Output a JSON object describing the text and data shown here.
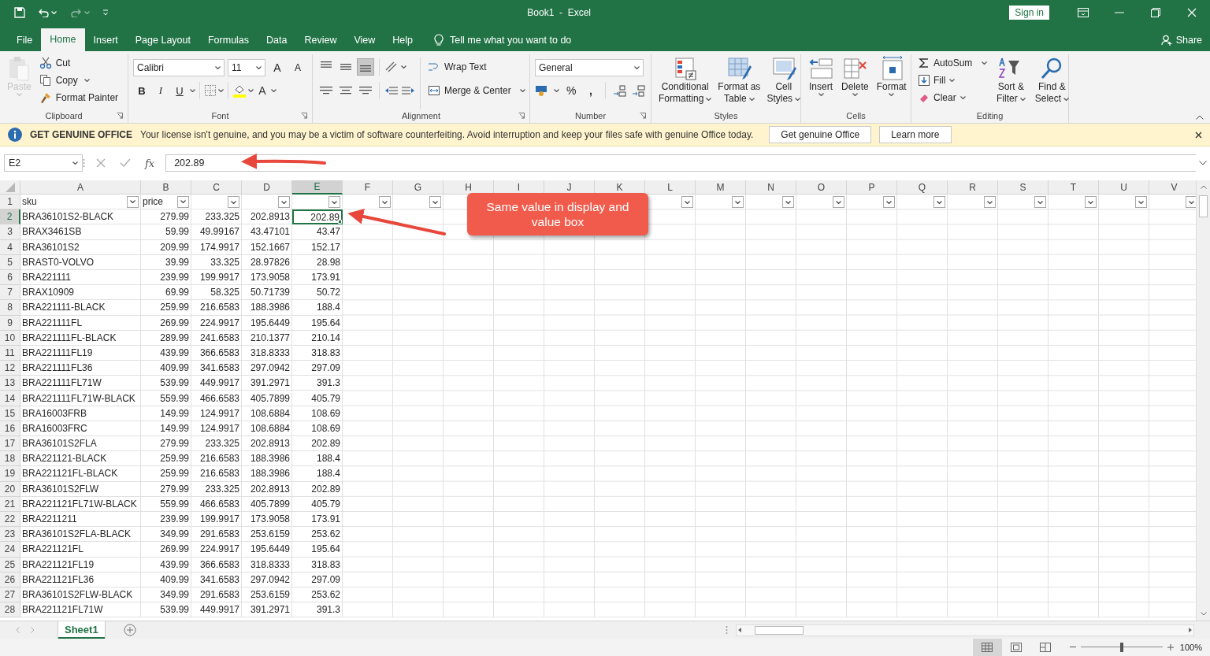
{
  "title_bar": {
    "title": "Book1  -  Excel",
    "sign_in": "Sign in"
  },
  "tabs": [
    {
      "label": "File",
      "selected": false
    },
    {
      "label": "Home",
      "selected": true
    },
    {
      "label": "Insert",
      "selected": false
    },
    {
      "label": "Page Layout",
      "selected": false
    },
    {
      "label": "Formulas",
      "selected": false
    },
    {
      "label": "Data",
      "selected": false
    },
    {
      "label": "Review",
      "selected": false
    },
    {
      "label": "View",
      "selected": false
    },
    {
      "label": "Help",
      "selected": false
    }
  ],
  "tell_me": "Tell me what you want to do",
  "share": "Share",
  "ribbon": {
    "clipboard": {
      "label": "Clipboard",
      "paste": {
        "label": "Paste",
        "disabled": true
      },
      "cut": "Cut",
      "copy": "Copy",
      "format_painter": "Format Painter"
    },
    "font": {
      "label": "Font",
      "name": "Calibri",
      "size": "11",
      "grow": "A",
      "shrink": "A",
      "bold": "B",
      "italic": "I",
      "underline": "U",
      "font_color_label": "A"
    },
    "alignment": {
      "label": "Alignment",
      "vertical": [
        {
          "selected": false
        },
        {
          "selected": false
        },
        {
          "selected": true
        }
      ],
      "wrap": "Wrap Text",
      "merge": "Merge & Center"
    },
    "number": {
      "label": "Number",
      "format": "General",
      "percent": "%",
      "comma": ","
    },
    "styles": {
      "label": "Styles",
      "buttons": [
        {
          "lines": [
            "Conditional",
            "Formatting"
          ]
        },
        {
          "lines": [
            "Format as",
            "Table"
          ]
        },
        {
          "lines": [
            "Cell",
            "Styles"
          ]
        }
      ]
    },
    "cells": {
      "label": "Cells",
      "buttons": [
        {
          "lines": [
            "Insert"
          ]
        },
        {
          "lines": [
            "Delete"
          ]
        },
        {
          "lines": [
            "Format"
          ]
        }
      ]
    },
    "editing": {
      "label": "Editing",
      "autosum": "AutoSum",
      "fill": "Fill",
      "clear": "Clear",
      "buttons": [
        {
          "lines": [
            "Sort &",
            "Filter"
          ]
        },
        {
          "lines": [
            "Find &",
            "Select"
          ]
        }
      ]
    }
  },
  "notice": {
    "title": "GET GENUINE OFFICE",
    "message": "Your license isn't genuine, and you may be a victim of software counterfeiting. Avoid interruption and keep your files safe with genuine Office today.",
    "buttons": [
      "Get genuine Office",
      "Learn more"
    ]
  },
  "formula_bar": {
    "name_box": "E2",
    "function": "fx",
    "value": "202.89"
  },
  "columns": [
    {
      "label": "A",
      "selected": false,
      "filter": true,
      "heading": "sku"
    },
    {
      "label": "B",
      "selected": false,
      "filter": true,
      "heading": "price"
    },
    {
      "label": "C",
      "selected": false,
      "filter": true
    },
    {
      "label": "D",
      "selected": false,
      "filter": true
    },
    {
      "label": "E",
      "selected": true,
      "filter": true
    },
    {
      "label": "F",
      "selected": false,
      "filter": true
    },
    {
      "label": "G",
      "selected": false,
      "filter": true
    },
    {
      "label": "H",
      "selected": false
    },
    {
      "label": "I",
      "selected": false
    },
    {
      "label": "J",
      "selected": false
    },
    {
      "label": "K",
      "selected": false
    },
    {
      "label": "L",
      "selected": false,
      "filter": true
    },
    {
      "label": "M",
      "selected": false,
      "filter": true
    },
    {
      "label": "N",
      "selected": false,
      "filter": true
    },
    {
      "label": "O",
      "selected": false,
      "filter": true
    },
    {
      "label": "P",
      "selected": false,
      "filter": true
    },
    {
      "label": "Q",
      "selected": false,
      "filter": true
    },
    {
      "label": "R",
      "selected": false,
      "filter": true
    },
    {
      "label": "S",
      "selected": false,
      "filter": true
    },
    {
      "label": "T",
      "selected": false,
      "filter": true
    },
    {
      "label": "U",
      "selected": false,
      "filter": true
    },
    {
      "label": "V",
      "selected": false,
      "filter": true
    }
  ],
  "header_row": "1",
  "rows": [
    {
      "number": "2",
      "selected": true,
      "cells": [
        "BRA36101S2-BLACK",
        "279.99",
        "233.325",
        "202.8913",
        "202.89"
      ]
    },
    {
      "number": "3",
      "selected": false,
      "cells": [
        "BRAX3461SB",
        "59.99",
        "49.99167",
        "43.47101",
        "43.47"
      ]
    },
    {
      "number": "4",
      "selected": false,
      "cells": [
        "BRA36101S2",
        "209.99",
        "174.9917",
        "152.1667",
        "152.17"
      ]
    },
    {
      "number": "5",
      "selected": false,
      "cells": [
        "BRAST0-VOLVO",
        "39.99",
        "33.325",
        "28.97826",
        "28.98"
      ]
    },
    {
      "number": "6",
      "selected": false,
      "cells": [
        "BRA221111",
        "239.99",
        "199.9917",
        "173.9058",
        "173.91"
      ]
    },
    {
      "number": "7",
      "selected": false,
      "cells": [
        "BRAX10909",
        "69.99",
        "58.325",
        "50.71739",
        "50.72"
      ]
    },
    {
      "number": "8",
      "selected": false,
      "cells": [
        "BRA221111-BLACK",
        "259.99",
        "216.6583",
        "188.3986",
        "188.4"
      ]
    },
    {
      "number": "9",
      "selected": false,
      "cells": [
        "BRA221111FL",
        "269.99",
        "224.9917",
        "195.6449",
        "195.64"
      ]
    },
    {
      "number": "10",
      "selected": false,
      "cells": [
        "BRA221111FL-BLACK",
        "289.99",
        "241.6583",
        "210.1377",
        "210.14"
      ]
    },
    {
      "number": "11",
      "selected": false,
      "cells": [
        "BRA221111FL19",
        "439.99",
        "366.6583",
        "318.8333",
        "318.83"
      ]
    },
    {
      "number": "12",
      "selected": false,
      "cells": [
        "BRA221111FL36",
        "409.99",
        "341.6583",
        "297.0942",
        "297.09"
      ]
    },
    {
      "number": "13",
      "selected": false,
      "cells": [
        "BRA221111FL71W",
        "539.99",
        "449.9917",
        "391.2971",
        "391.3"
      ]
    },
    {
      "number": "14",
      "selected": false,
      "cells": [
        "BRA221111FL71W-BLACK",
        "559.99",
        "466.6583",
        "405.7899",
        "405.79"
      ]
    },
    {
      "number": "15",
      "selected": false,
      "cells": [
        "BRA16003FRB",
        "149.99",
        "124.9917",
        "108.6884",
        "108.69"
      ]
    },
    {
      "number": "16",
      "selected": false,
      "cells": [
        "BRA16003FRC",
        "149.99",
        "124.9917",
        "108.6884",
        "108.69"
      ]
    },
    {
      "number": "17",
      "selected": false,
      "cells": [
        "BRA36101S2FLA",
        "279.99",
        "233.325",
        "202.8913",
        "202.89"
      ]
    },
    {
      "number": "18",
      "selected": false,
      "cells": [
        "BRA221121-BLACK",
        "259.99",
        "216.6583",
        "188.3986",
        "188.4"
      ]
    },
    {
      "number": "19",
      "selected": false,
      "cells": [
        "BRA221121FL-BLACK",
        "259.99",
        "216.6583",
        "188.3986",
        "188.4"
      ]
    },
    {
      "number": "20",
      "selected": false,
      "cells": [
        "BRA36101S2FLW",
        "279.99",
        "233.325",
        "202.8913",
        "202.89"
      ]
    },
    {
      "number": "21",
      "selected": false,
      "cells": [
        "BRA221121FL71W-BLACK",
        "559.99",
        "466.6583",
        "405.7899",
        "405.79"
      ]
    },
    {
      "number": "22",
      "selected": false,
      "cells": [
        "BRA2211211",
        "239.99",
        "199.9917",
        "173.9058",
        "173.91"
      ]
    },
    {
      "number": "23",
      "selected": false,
      "cells": [
        "BRA36101S2FLA-BLACK",
        "349.99",
        "291.6583",
        "253.6159",
        "253.62"
      ]
    },
    {
      "number": "24",
      "selected": false,
      "cells": [
        "BRA221121FL",
        "269.99",
        "224.9917",
        "195.6449",
        "195.64"
      ]
    },
    {
      "number": "25",
      "selected": false,
      "cells": [
        "BRA221121FL19",
        "439.99",
        "366.6583",
        "318.8333",
        "318.83"
      ]
    },
    {
      "number": "26",
      "selected": false,
      "cells": [
        "BRA221121FL36",
        "409.99",
        "341.6583",
        "297.0942",
        "297.09"
      ]
    },
    {
      "number": "27",
      "selected": false,
      "cells": [
        "BRA36101S2FLW-BLACK",
        "349.99",
        "291.6583",
        "253.6159",
        "253.62"
      ]
    },
    {
      "number": "28",
      "selected": false,
      "cells": [
        "BRA221121FL71W",
        "539.99",
        "449.9917",
        "391.2971",
        "391.3"
      ]
    }
  ],
  "callout": "Same value in display and value box",
  "sheets": [
    {
      "label": "Sheet1",
      "selected": true
    }
  ],
  "status_bar": {
    "views": [
      {
        "selected": true
      },
      {
        "selected": false
      },
      {
        "selected": false
      }
    ],
    "zoom": {
      "level": 0.5
    },
    "zoom_text": "100%"
  }
}
